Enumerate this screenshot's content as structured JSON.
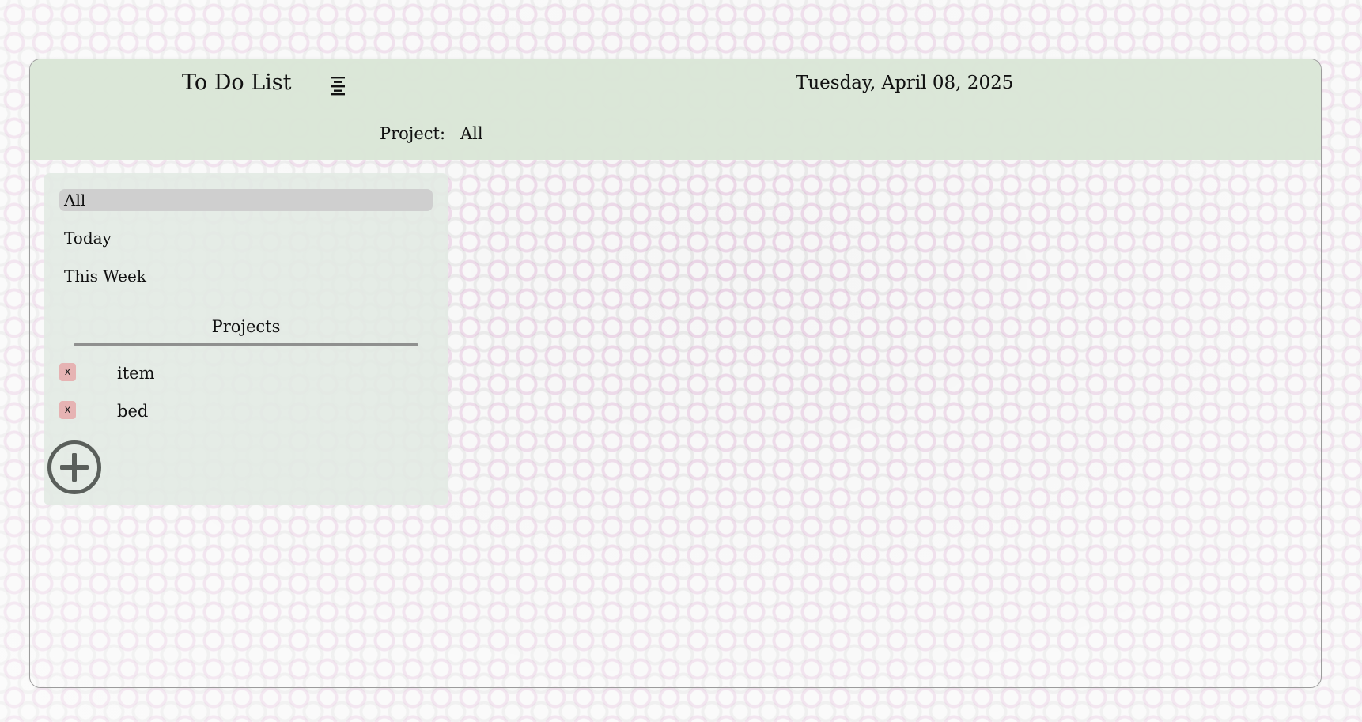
{
  "header": {
    "title": "To Do List",
    "menu_icon": "menu-icon",
    "date": "Tuesday, April 08, 2025",
    "project_label": "Project:",
    "project_value": "All"
  },
  "sidebar": {
    "nav_items": [
      {
        "label": "All",
        "active": true
      },
      {
        "label": "Today",
        "active": false
      },
      {
        "label": "This Week",
        "active": false
      }
    ],
    "projects_heading": "Projects",
    "projects": [
      {
        "name": "item",
        "delete_label": "x"
      },
      {
        "name": "bed",
        "delete_label": "x"
      }
    ],
    "add_icon": "plus-circle-icon"
  },
  "colors": {
    "header_bg": "#dae6d7",
    "sidebar_bg": "#e2eae3",
    "active_item_bg": "#cfcfcf",
    "delete_button_bg": "#e6b3b3",
    "add_icon": "#5a5f5b"
  }
}
